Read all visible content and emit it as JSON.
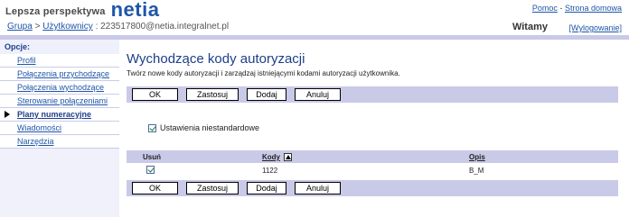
{
  "header": {
    "tagline": "Lepsza perspektywa",
    "logo": "netia",
    "help_link": "Pomoc",
    "separator": "-",
    "home_link": "Strona domowa",
    "crumb_group": "Grupa",
    "crumb_sep": ">",
    "crumb_users": "Użytkownicy",
    "crumb_current": ": 223517800@netia.integralnet.pl",
    "welcome": "Witamy",
    "logout": "[Wylogowanie]"
  },
  "sidebar": {
    "title": "Opcje:",
    "items": [
      {
        "label": "Profil"
      },
      {
        "label": "Połączenia przychodzące"
      },
      {
        "label": "Połączenia wychodzące"
      },
      {
        "label": "Sterowanie połączeniami"
      },
      {
        "label": "Plany numeracyjne"
      },
      {
        "label": "Wiadomości"
      },
      {
        "label": "Narzędzia"
      }
    ],
    "active_index": 4
  },
  "main": {
    "title": "Wychodzące kody autoryzacji",
    "description": "Twórz nowe kody autoryzacji i zarządzaj istniejącymi kodami autoryzacji użytkownika.",
    "buttons": {
      "ok": "OK",
      "apply": "Zastosuj",
      "add": "Dodaj",
      "cancel": "Anuluj"
    },
    "custom_settings": {
      "label": "Ustawienia niestandardowe",
      "checked": true
    },
    "table": {
      "headers": {
        "delete": "Usuń",
        "codes": "Kody",
        "description": "Opis"
      },
      "rows": [
        {
          "delete": true,
          "code": "1122",
          "description": "B_M"
        }
      ]
    }
  },
  "colors": {
    "brand_blue": "#1e56a8",
    "bar_lavender": "#c9c9e8",
    "title_blue": "#1e3e8a"
  }
}
